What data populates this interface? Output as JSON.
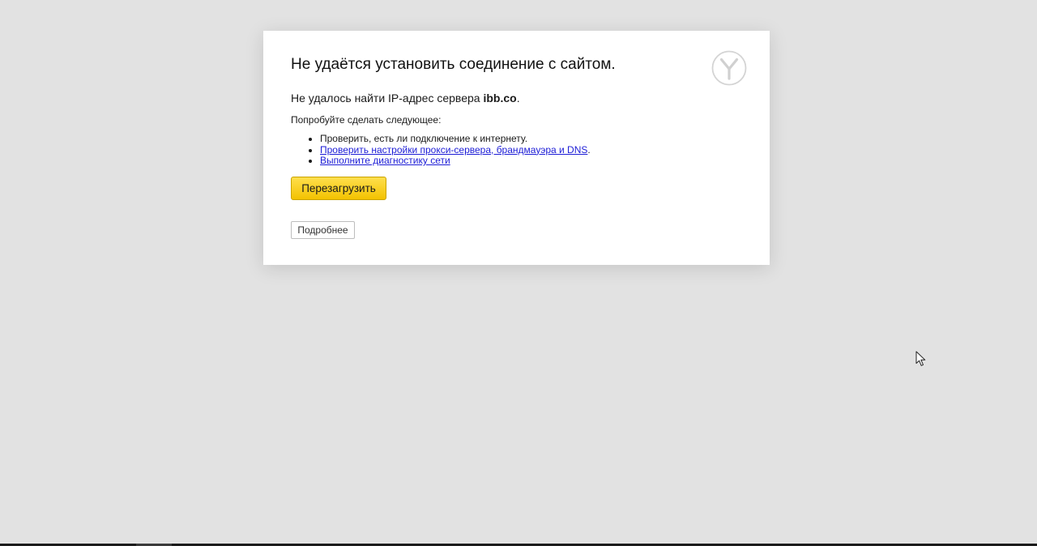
{
  "error": {
    "title": "Не удаётся установить соединение с сайтом.",
    "message_prefix": "Не удалось найти IP-адрес сервера ",
    "host": "ibb.co",
    "message_suffix": ".",
    "try_label": "Попробуйте сделать следующее:",
    "suggestions": [
      {
        "text": "Проверить, есть ли подключение к интернету."
      },
      {
        "link": "Проверить настройки прокси-сервера, брандмауэра и DNS",
        "suffix": "."
      },
      {
        "link": "Выполните диагностику сети"
      }
    ]
  },
  "buttons": {
    "reload": "Перезагрузить",
    "details": "Подробнее"
  },
  "colors": {
    "background": "#e2e2e2",
    "card": "#ffffff",
    "reload_button": "#f5c700",
    "link": "#1c1cd6"
  },
  "icons": {
    "logo": "yandex-browser-logo-icon",
    "cursor": "mouse-pointer-icon"
  }
}
